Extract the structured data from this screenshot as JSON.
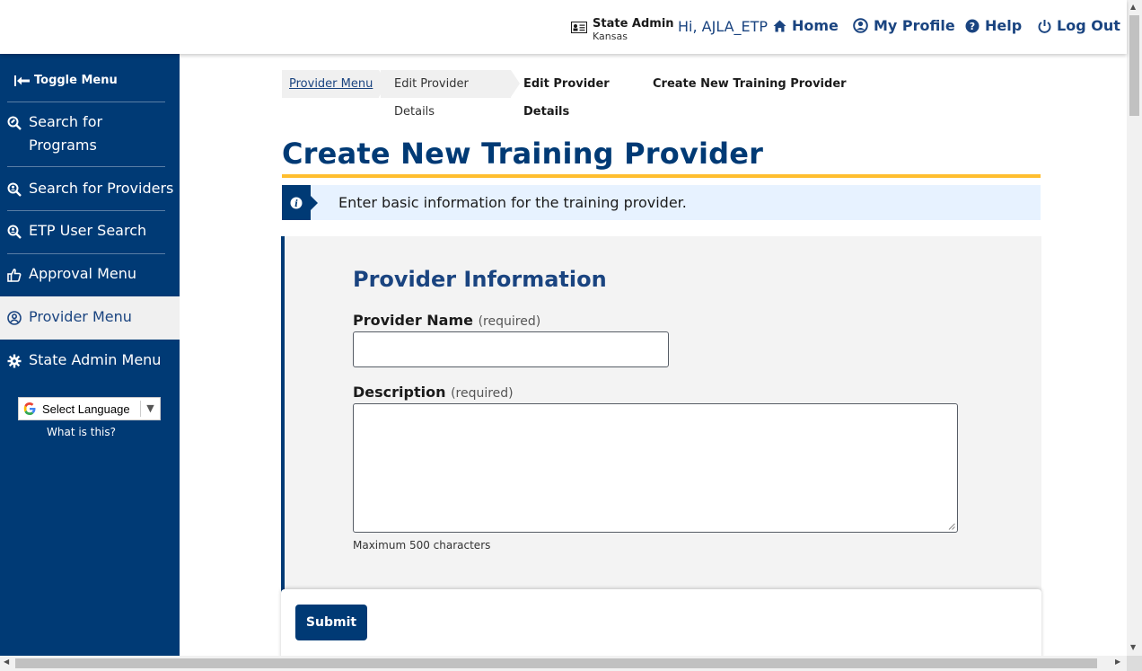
{
  "header": {
    "role_title": "State Admin",
    "role_state": "Kansas",
    "greeting": "Hi, AJLA_ETP",
    "links": {
      "home": "Home",
      "profile": "My Profile",
      "help": "Help",
      "logout": "Log Out"
    },
    "icons": [
      "id-card-icon",
      "home-icon",
      "user-circle-icon",
      "question-circle-icon",
      "power-icon"
    ]
  },
  "sidebar": {
    "toggle_label": "Toggle Menu",
    "items": [
      {
        "label": "Search for Programs",
        "icon": "search-programs-icon"
      },
      {
        "label": "Search for Providers",
        "icon": "search-providers-icon"
      },
      {
        "label": "ETP User Search",
        "icon": "user-search-icon"
      },
      {
        "label": "Approval Menu",
        "icon": "thumbs-up-icon"
      },
      {
        "label": "Provider Menu",
        "icon": "provider-icon",
        "active": true
      },
      {
        "label": "State Admin Menu",
        "icon": "gear-icon"
      }
    ],
    "language": {
      "select_label": "Select Language",
      "what_is_this": "What is this?"
    }
  },
  "breadcrumb": {
    "items": [
      "Provider Menu",
      "Edit Provider Details",
      "Edit Provider Details",
      "Create New Training Provider"
    ]
  },
  "page": {
    "title": "Create New Training Provider",
    "alert_text": "Enter basic information for the training provider."
  },
  "form": {
    "section_title": "Provider Information",
    "provider_name_label": "Provider Name",
    "provider_name_req": "(required)",
    "provider_name_value": "",
    "description_label": "Description",
    "description_req": "(required)",
    "description_value": "",
    "description_hint": "Maximum 500 characters",
    "submit_label": "Submit"
  },
  "colors": {
    "primary": "#003a75",
    "link": "#1a4480",
    "accent_rule": "#ffbe2e",
    "alert_bg": "#e7f2ff",
    "panel_bg": "#f3f3f3"
  }
}
